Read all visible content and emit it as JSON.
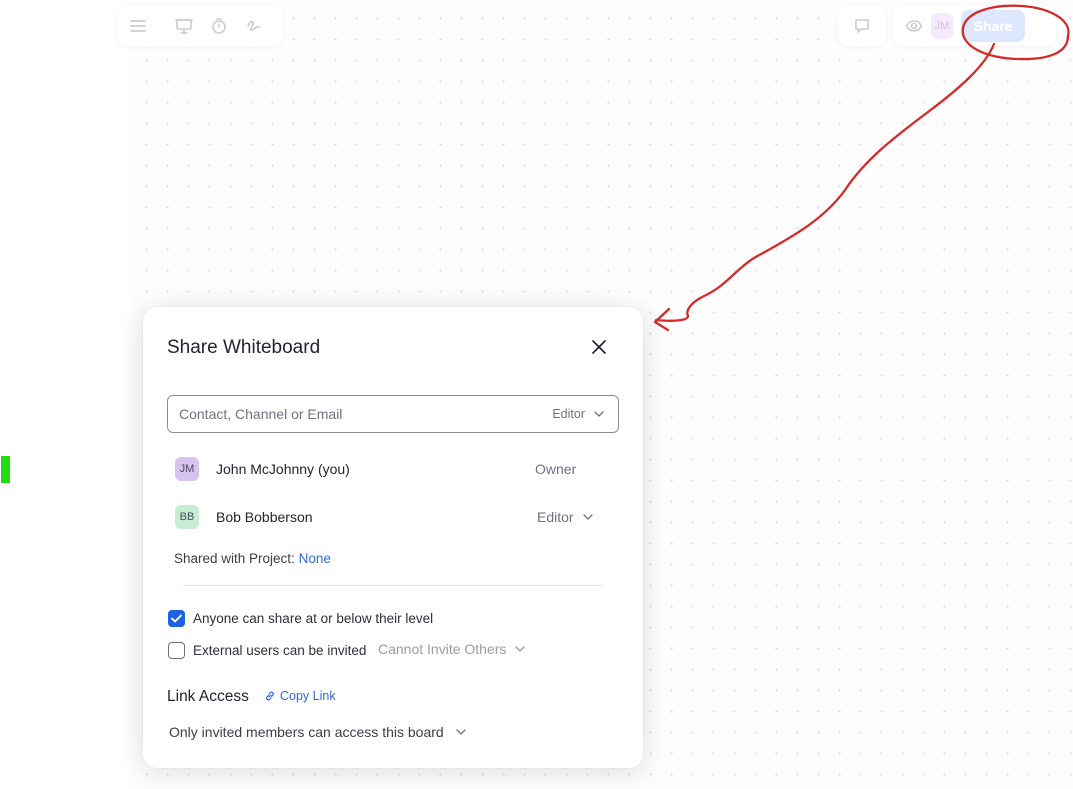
{
  "toolbar": {
    "left_icons": [
      "menu-icon",
      "presentation-icon",
      "timer-icon",
      "pen-icon"
    ],
    "right_avatar_initials": "JM",
    "share_label": "Share"
  },
  "dialog": {
    "title": "Share Whiteboard",
    "invite": {
      "placeholder": "Contact, Channel or Email",
      "role": "Editor"
    },
    "members": [
      {
        "initials": "JM",
        "name": "John McJohnny (you)",
        "role": "Owner",
        "avatar_color": "#d7c3f0"
      },
      {
        "initials": "BB",
        "name": "Bob Bobberson",
        "role": "Editor",
        "avatar_color": "#c6ecd3"
      }
    ],
    "shared_project": {
      "label": "Shared with Project:",
      "value": "None"
    },
    "options": {
      "anyone_share": {
        "label": "Anyone can share at or below their level",
        "checked": true
      },
      "external_users": {
        "label": "External users can be invited",
        "checked": false,
        "setting": "Cannot Invite Others"
      }
    },
    "link_access": {
      "heading": "Link Access",
      "copy_label": "Copy Link",
      "setting": "Only invited members can access this board"
    }
  },
  "colors": {
    "accent": "#1f62e0",
    "link": "#2e6ad6",
    "annotation": "#d42a2a",
    "marker": "#22dd11"
  }
}
